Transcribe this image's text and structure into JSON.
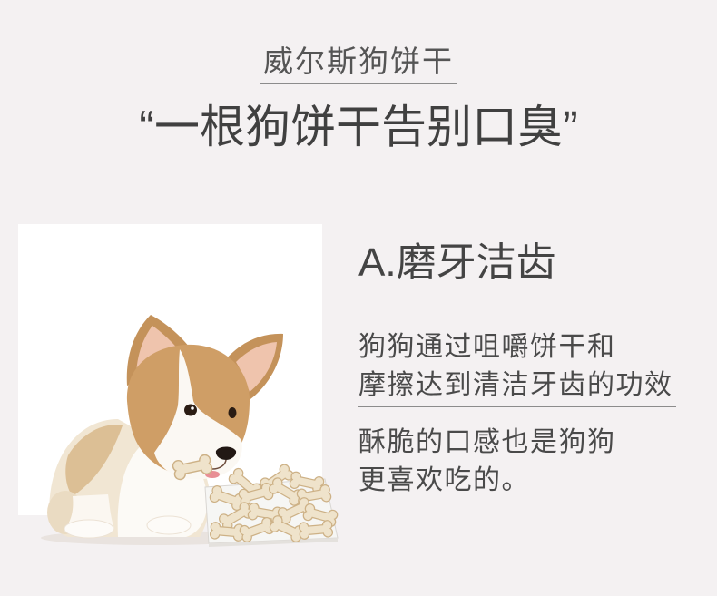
{
  "brand": {
    "title": "威尔斯狗饼干"
  },
  "headline": "“一根狗饼干告别口臭”",
  "feature": {
    "heading": "A.磨牙洁齿",
    "paragraph_1": [
      "狗狗通过咀嚼饼干和",
      "摩擦达到清洁牙齿的功效"
    ],
    "paragraph_2": [
      "酥脆的口感也是狗狗",
      "更喜欢吃的。"
    ]
  },
  "colors": {
    "background": "#f4f1f2",
    "panel": "#ffffff",
    "text": "#4a4a4a",
    "rule": "#8c8c8c"
  }
}
